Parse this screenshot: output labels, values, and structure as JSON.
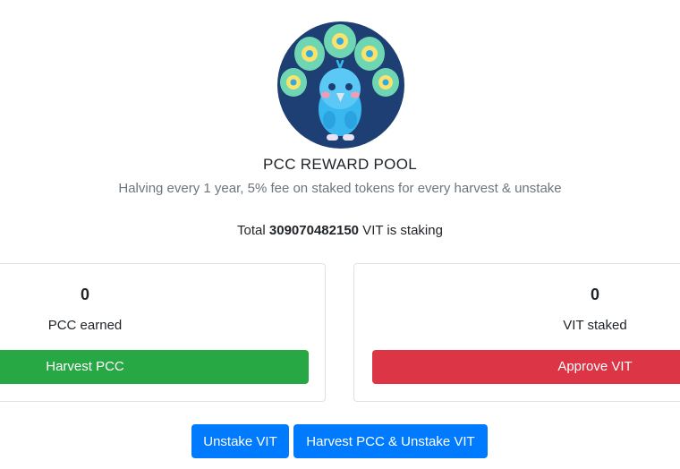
{
  "pool": {
    "title": "PCC REWARD POOL",
    "subtitle": "Halving every 1 year, 5% fee on staked tokens for every harvest & unstake",
    "total_prefix": "Total ",
    "total_amount": "309070482150",
    "total_suffix": " VIT is staking",
    "logo_icon": "peacock-logo-icon"
  },
  "earned_card": {
    "amount": "0",
    "label": "PCC earned",
    "button_label": "Harvest PCC",
    "button_color": "#28a745"
  },
  "staked_card": {
    "amount": "0",
    "label": "VIT staked",
    "button_label": "Approve VIT",
    "button_color": "#dc3545"
  },
  "actions": {
    "unstake_label": "Unstake VIT",
    "harvest_unstake_label": "Harvest PCC & Unstake VIT",
    "button_color": "#007bff"
  }
}
